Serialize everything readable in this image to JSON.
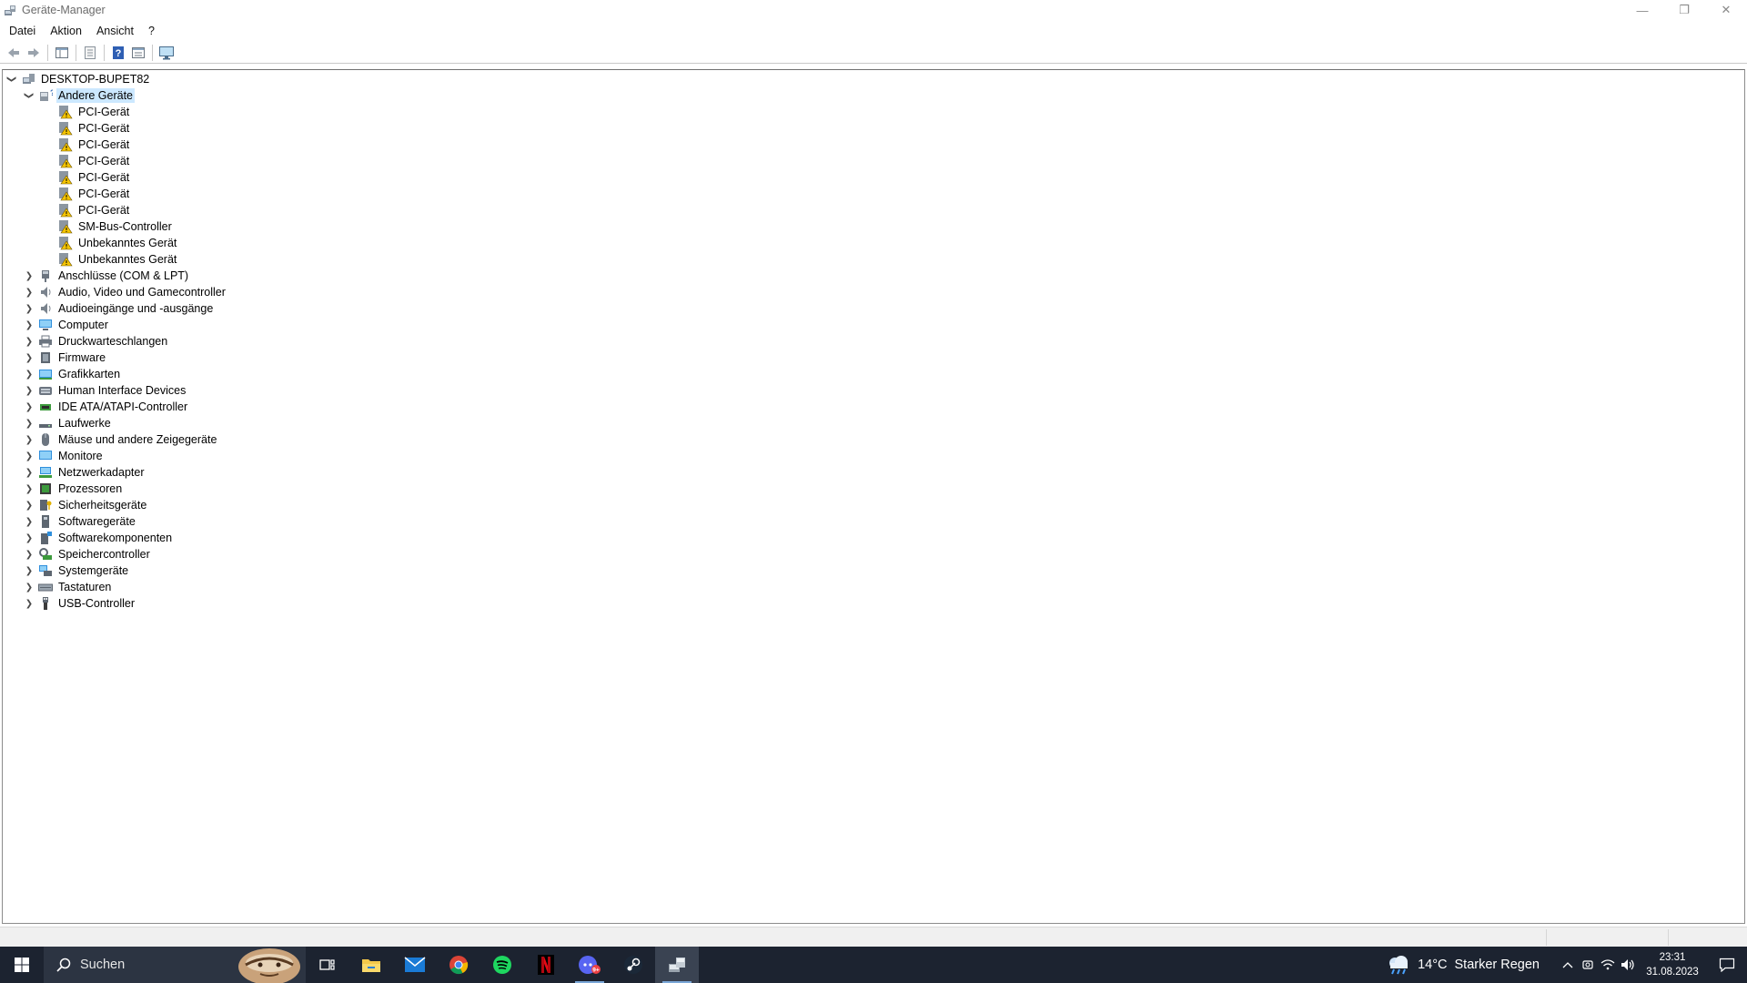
{
  "window": {
    "title": "Geräte-Manager",
    "controls": {
      "minimize": "—",
      "restore": "❐",
      "close": "✕"
    }
  },
  "menu": [
    "Datei",
    "Aktion",
    "Ansicht",
    "?"
  ],
  "toolbar": {
    "buttons": [
      "back-icon",
      "forward-icon",
      "tree-view-icon",
      "properties-icon",
      "help-icon",
      "details-view-icon",
      "computer-monitor-icon"
    ]
  },
  "tree": {
    "root": {
      "label": "DESKTOP-BUPET82",
      "expanded": true
    },
    "other_devices": {
      "label": "Andere Geräte",
      "expanded": true,
      "selected": true,
      "children": [
        "PCI-Gerät",
        "PCI-Gerät",
        "PCI-Gerät",
        "PCI-Gerät",
        "PCI-Gerät",
        "PCI-Gerät",
        "PCI-Gerät",
        "SM-Bus-Controller",
        "Unbekanntes Gerät",
        "Unbekanntes Gerät"
      ]
    },
    "categories": [
      {
        "label": "Anschlüsse (COM & LPT)",
        "icon": "port-icon"
      },
      {
        "label": "Audio, Video und Gamecontroller",
        "icon": "speaker-icon"
      },
      {
        "label": "Audioeingänge und -ausgänge",
        "icon": "speaker-icon"
      },
      {
        "label": "Computer",
        "icon": "computer-icon"
      },
      {
        "label": "Druckwarteschlangen",
        "icon": "printer-icon"
      },
      {
        "label": "Firmware",
        "icon": "firmware-icon"
      },
      {
        "label": "Grafikkarten",
        "icon": "display-adapter-icon"
      },
      {
        "label": "Human Interface Devices",
        "icon": "hid-icon"
      },
      {
        "label": "IDE ATA/ATAPI-Controller",
        "icon": "ide-controller-icon"
      },
      {
        "label": "Laufwerke",
        "icon": "drive-icon"
      },
      {
        "label": "Mäuse und andere Zeigegeräte",
        "icon": "mouse-icon"
      },
      {
        "label": "Monitore",
        "icon": "monitor-icon"
      },
      {
        "label": "Netzwerkadapter",
        "icon": "network-adapter-icon"
      },
      {
        "label": "Prozessoren",
        "icon": "processor-icon"
      },
      {
        "label": "Sicherheitsgeräte",
        "icon": "security-device-icon"
      },
      {
        "label": "Softwaregeräte",
        "icon": "software-device-icon"
      },
      {
        "label": "Softwarekomponenten",
        "icon": "software-component-icon"
      },
      {
        "label": "Speichercontroller",
        "icon": "storage-controller-icon"
      },
      {
        "label": "Systemgeräte",
        "icon": "system-device-icon"
      },
      {
        "label": "Tastaturen",
        "icon": "keyboard-icon"
      },
      {
        "label": "USB-Controller",
        "icon": "usb-icon"
      }
    ]
  },
  "taskbar": {
    "search_placeholder": "Suchen",
    "apps": [
      "task-view-icon",
      "file-explorer-icon",
      "mail-icon",
      "chrome-icon",
      "spotify-icon",
      "netflix-icon",
      "discord-icon",
      "steam-icon",
      "device-manager-icon"
    ],
    "active_app": "device-manager-icon",
    "discord_badge": "9+",
    "weather": {
      "temperature": "14°C",
      "condition": "Starker Regen"
    },
    "clock": {
      "time": "23:31",
      "date": "31.08.2023"
    }
  },
  "colors": {
    "selection": "#cce8ff",
    "taskbar": "#1c2330",
    "warning": "#f5c400"
  }
}
